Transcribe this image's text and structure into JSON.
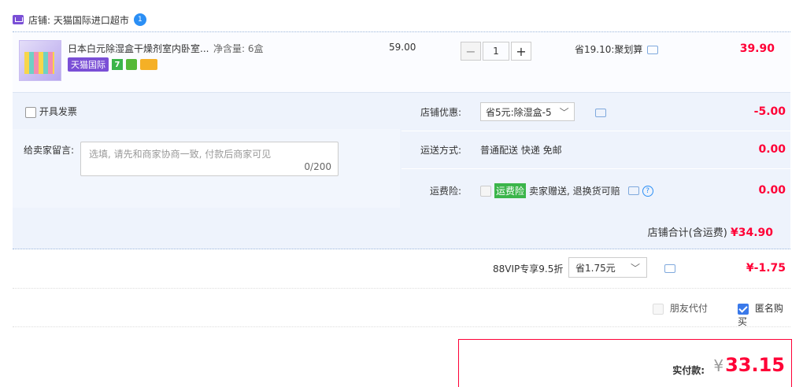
{
  "shop": {
    "label": "店铺: 天猫国际进口超市",
    "ww_badge": "1"
  },
  "item": {
    "title": "日本白元除湿盒干燥剂室内卧室...",
    "spec": "净含量: 6盒",
    "tag_tmall": "天猫国际",
    "tag_seven": "7",
    "price": "59.00",
    "qty": "1",
    "promo": "省19.10:聚划算",
    "total": "39.90"
  },
  "options": {
    "invoice_label": "开具发票",
    "msg_label": "给卖家留言:",
    "msg_placeholder": "选填, 请先和商家协商一致, 付款后商家可见",
    "msg_count": "0/200",
    "shop_discount_label": "店铺优惠:",
    "shop_discount_value": "省5元:除湿盒-5",
    "shop_discount_amount": "-5.00",
    "shipping_label": "运送方式:",
    "shipping_value": "普通配送 快递 免邮",
    "shipping_amount": "0.00",
    "insurance_label": "运费险:",
    "insurance_tag": "运费险",
    "insurance_desc": "卖家赠送, 退换货可赔",
    "insurance_amount": "0.00",
    "shop_total_label": "店铺合计(含运费)",
    "shop_total_value": "¥34.90"
  },
  "vip": {
    "label": "88VIP专享9.5折",
    "select_value": "省1.75元",
    "amount": "¥-1.75"
  },
  "extras": {
    "friend_pay": "朋友代付",
    "anonymous": "匿名购买",
    "anonymous_checked": true
  },
  "pay": {
    "label": "实付款:",
    "currency": "¥",
    "amount": "33.15"
  },
  "colors": {
    "accent": "#ff0036",
    "tmall_purple": "#7a4fd6",
    "link_blue": "#3a79ea"
  }
}
